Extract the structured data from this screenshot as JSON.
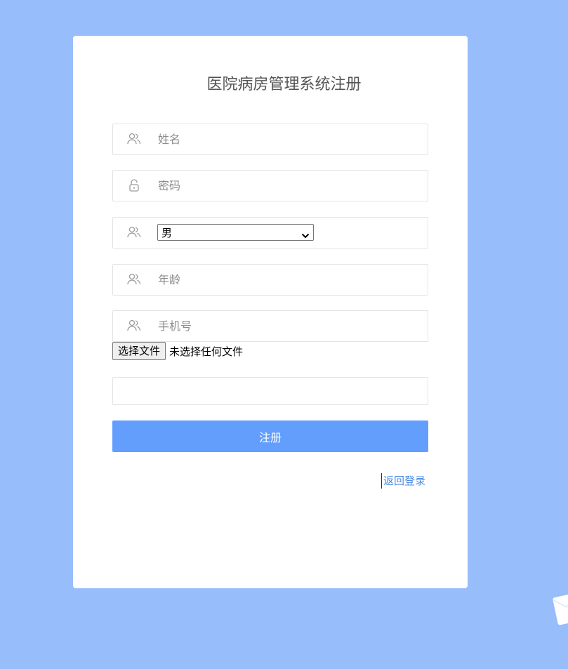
{
  "form": {
    "title": "医院病房管理系统注册",
    "name_placeholder": "姓名",
    "password_placeholder": "密码",
    "gender_selected": "男",
    "age_placeholder": "年龄",
    "phone_placeholder": "手机号",
    "file_button_label": "选择文件",
    "file_status": "未选择任何文件",
    "submit_label": "注册",
    "back_link_label": "返回登录"
  },
  "icons": {
    "name": "users-icon",
    "password": "lock-icon",
    "gender": "users-icon",
    "age": "users-icon",
    "phone": "users-icon",
    "select_arrow": "chevron-down-icon",
    "decoration": "envelope-icon"
  },
  "colors": {
    "background": "#97bdfa",
    "card": "#ffffff",
    "primary_button": "#639efc",
    "link": "#4a8be6",
    "icon": "#9a9a9a"
  }
}
